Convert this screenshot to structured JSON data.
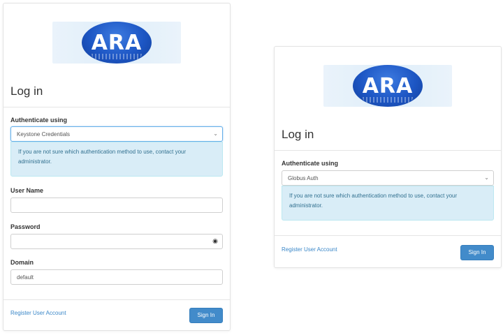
{
  "left": {
    "logo_text": "ARA",
    "title": "Log in",
    "authenticate_label": "Authenticate using",
    "auth_method": "Keystone Credentials",
    "info_text": "If you are not sure which authentication method to use, contact your administrator.",
    "username_label": "User Name",
    "username_value": "",
    "password_label": "Password",
    "password_value": "",
    "domain_label": "Domain",
    "domain_value": "default",
    "register_link": "Register User Account",
    "signin_label": "Sign In"
  },
  "right": {
    "logo_text": "ARA",
    "title": "Log in",
    "authenticate_label": "Authenticate using",
    "auth_method": "Globus Auth",
    "info_text": "If you are not sure which authentication method to use, contact your administrator.",
    "register_link": "Register User Account",
    "signin_label": "Sign In"
  },
  "colors": {
    "accent": "#428bca",
    "link": "#3a87c8",
    "info_bg": "#d9edf7",
    "info_text": "#31708f",
    "logo_blue": "#1d56c4"
  },
  "icons": {
    "select_arrow": "chevron-down-icon",
    "password_toggle": "eye-icon"
  }
}
